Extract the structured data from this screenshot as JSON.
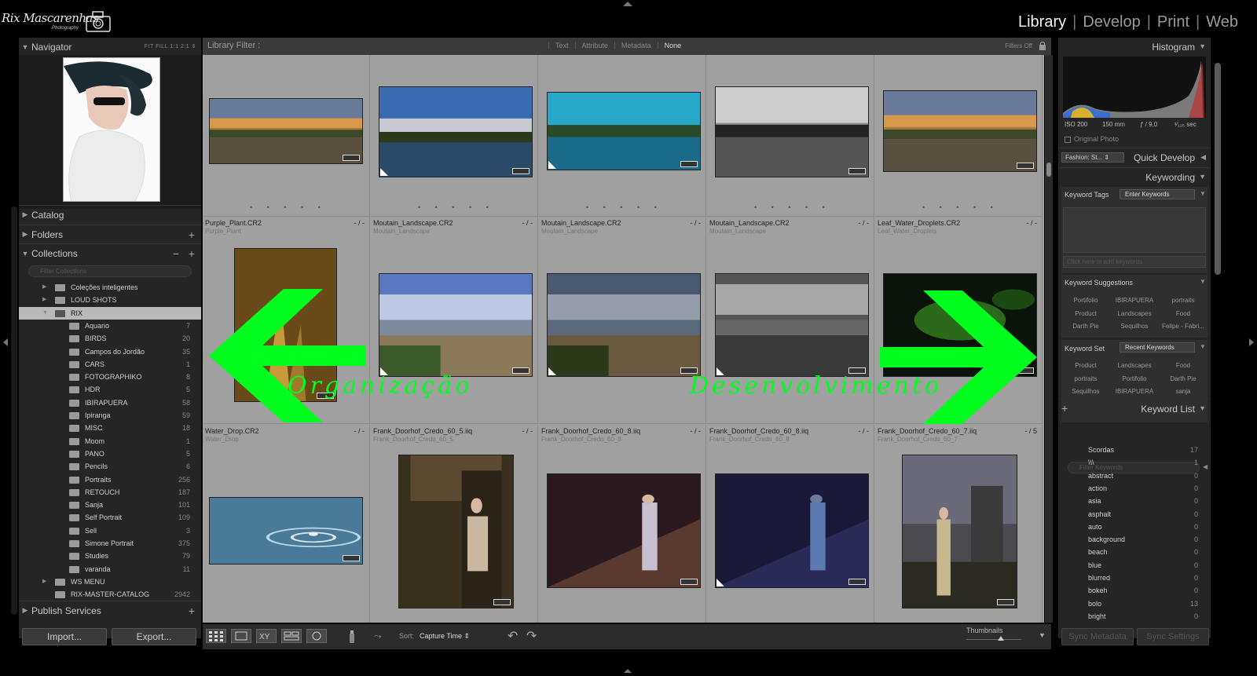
{
  "header": {
    "logo_text": "Rix Mascarenhas",
    "logo_subtext": "Photography",
    "modules": [
      {
        "label": "Library",
        "active": true
      },
      {
        "label": "Develop",
        "active": false
      },
      {
        "label": "Print",
        "active": false
      },
      {
        "label": "Web",
        "active": false
      }
    ],
    "separator": "|"
  },
  "navigator": {
    "title": "Navigator",
    "modes": "FIT  FILL  1:1  2:1 ⇕"
  },
  "left_panels": {
    "catalog": "Catalog",
    "folders": "Folders",
    "collections": "Collections",
    "filter_placeholder": "Filter Collections",
    "publish": "Publish Services",
    "import_label": "Import...",
    "export_label": "Export..."
  },
  "collections": [
    {
      "name": "Coleções inteligentes",
      "count": "",
      "level": 1,
      "expanded": false
    },
    {
      "name": "LOUD SHOTS",
      "count": "",
      "level": 1,
      "expanded": false
    },
    {
      "name": "RIX",
      "count": "",
      "level": 1,
      "expanded": true,
      "selected": true
    },
    {
      "name": "Aquario",
      "count": "7",
      "level": 2
    },
    {
      "name": "BIRDS",
      "count": "20",
      "level": 2
    },
    {
      "name": "Campos do Jordão",
      "count": "35",
      "level": 2
    },
    {
      "name": "CARS",
      "count": "1",
      "level": 2
    },
    {
      "name": "FOTOGRAPHIKO",
      "count": "8",
      "level": 2
    },
    {
      "name": "HDR",
      "count": "5",
      "level": 2
    },
    {
      "name": "IBIRAPUERA",
      "count": "58",
      "level": 2
    },
    {
      "name": "Ipiranga",
      "count": "59",
      "level": 2
    },
    {
      "name": "MISC",
      "count": "18",
      "level": 2
    },
    {
      "name": "Moom",
      "count": "1",
      "level": 2
    },
    {
      "name": "PANO",
      "count": "5",
      "level": 2
    },
    {
      "name": "Pencils",
      "count": "6",
      "level": 2
    },
    {
      "name": "Portraits",
      "count": "256",
      "level": 2
    },
    {
      "name": "RETOUCH",
      "count": "187",
      "level": 2
    },
    {
      "name": "Sanja",
      "count": "101",
      "level": 2
    },
    {
      "name": "Self Portrait",
      "count": "109",
      "level": 2
    },
    {
      "name": "Sell",
      "count": "3",
      "level": 2
    },
    {
      "name": "Simone Portrait",
      "count": "375",
      "level": 2
    },
    {
      "name": "Studies",
      "count": "79",
      "level": 2
    },
    {
      "name": "varanda",
      "count": "11",
      "level": 2
    },
    {
      "name": "WS MENU",
      "count": "",
      "level": 1,
      "expanded": false
    },
    {
      "name": "RIX-MASTER-CATALOG",
      "count": "2942",
      "level": 1
    }
  ],
  "filter_bar": {
    "label": "Library Filter :",
    "options": [
      "Text",
      "Attribute",
      "Metadata",
      "None"
    ],
    "active": "None",
    "status": "Filters Off"
  },
  "grid": [
    {
      "filename": "",
      "subname": "",
      "rating": "",
      "palette": "sunset"
    },
    {
      "filename": "",
      "subname": "",
      "rating": "",
      "palette": "bluesky"
    },
    {
      "filename": "",
      "subname": "",
      "rating": "",
      "palette": "cyan"
    },
    {
      "filename": "",
      "subname": "",
      "rating": "",
      "palette": "bw"
    },
    {
      "filename": "",
      "subname": "",
      "rating": "",
      "palette": "sunset"
    },
    {
      "filename": "Purple_Plant.CR2",
      "subname": "Purple_Plant",
      "rating": "- / -",
      "palette": "plant"
    },
    {
      "filename": "Moutain_Landscape.CR2",
      "subname": "Moutain_Landscape",
      "rating": "- / -",
      "palette": "mountain"
    },
    {
      "filename": "Moutain_Landscape.CR2",
      "subname": "Moutain_Landscape",
      "rating": "- / -",
      "palette": "mountain2"
    },
    {
      "filename": "Moutain_Landscape.CR2",
      "subname": "Moutain_Landscape",
      "rating": "- / -",
      "palette": "mountainbw"
    },
    {
      "filename": "Leaf_Water_Droplets.CR2",
      "subname": "Leaf_Water_Droplets",
      "rating": "- / -",
      "palette": "leaf"
    },
    {
      "filename": "Water_Drop.CR2",
      "subname": "Water_Drop",
      "rating": "- / -",
      "palette": "water"
    },
    {
      "filename": "Frank_Doorhof_Credo_60_5.iiq",
      "subname": "Frank_Doorhof_Credo_60_5",
      "rating": "- / -",
      "palette": "dress"
    },
    {
      "filename": "Frank_Doorhof_Credo_60_8.iiq",
      "subname": "Frank_Doorhof_Credo_60_8",
      "rating": "- / -",
      "palette": "stairs"
    },
    {
      "filename": "Frank_Doorhof_Credo_60_8.iiq",
      "subname": "Frank_Doorhof_Credo_60_8",
      "rating": "- / -",
      "palette": "stairsblue"
    },
    {
      "filename": "Frank_Doorhof_Credo_60_7.iiq",
      "subname": "Frank_Doorhof_Credo_60_7",
      "rating": "- / 5",
      "palette": "castle"
    }
  ],
  "toolbar": {
    "sort_label": "Sort:",
    "sort_value": "Capture Time ⇕",
    "thumbnails_label": "Thumbnails"
  },
  "right_panels": {
    "histogram": "Histogram",
    "iso": "ISO 200",
    "focal": "150 mm",
    "aperture": "ƒ / 9,0",
    "shutter": "¹⁄₁₂₅ sec",
    "original_photo": "Original Photo",
    "preset": "Fashion: St...  ⇕",
    "quick_develop": "Quick Develop",
    "keywording": "Keywording",
    "keyword_tags_label": "Keyword Tags",
    "keyword_tags_value": "Enter Keywords",
    "add_keywords_hint": "Click here to add keywords",
    "suggestions_label": "Keyword Suggestions",
    "suggestions": [
      "Portifolio",
      "IBIRAPUERA",
      "portraits",
      "Product",
      "Landscapes",
      "Food",
      "Darth Pie",
      "Sequilhos",
      "Felipe - Fabri..."
    ],
    "keyword_set_label": "Keyword Set",
    "keyword_set_value": "Recent Keywords",
    "keyword_set": [
      "Product",
      "Landscapes",
      "Food",
      "portraits",
      "Portifolio",
      "Darth Pie",
      "Sequilhos",
      "IBIRAPUERA",
      "sanja"
    ],
    "keyword_list": "Keyword List",
    "keyword_filter_placeholder": "Filter Keywords",
    "sync_metadata": "Sync Metadata",
    "sync_settings": "Sync Settings"
  },
  "keywords": [
    {
      "name": "Scordas",
      "count": "17"
    },
    {
      "name": "\\\\\\",
      "count": "1"
    },
    {
      "name": "abstract",
      "count": "0"
    },
    {
      "name": "action",
      "count": "0"
    },
    {
      "name": "asia",
      "count": "0"
    },
    {
      "name": "asphalt",
      "count": "0"
    },
    {
      "name": "auto",
      "count": "0"
    },
    {
      "name": "background",
      "count": "0"
    },
    {
      "name": "beach",
      "count": "0"
    },
    {
      "name": "blue",
      "count": "0"
    },
    {
      "name": "blurred",
      "count": "0"
    },
    {
      "name": "bokeh",
      "count": "0"
    },
    {
      "name": "bolo",
      "count": "13"
    },
    {
      "name": "bright",
      "count": "0"
    }
  ],
  "overlay": {
    "left_text": "Organização",
    "right_text": "Desenvolvimento",
    "color": "#00ff1e"
  }
}
